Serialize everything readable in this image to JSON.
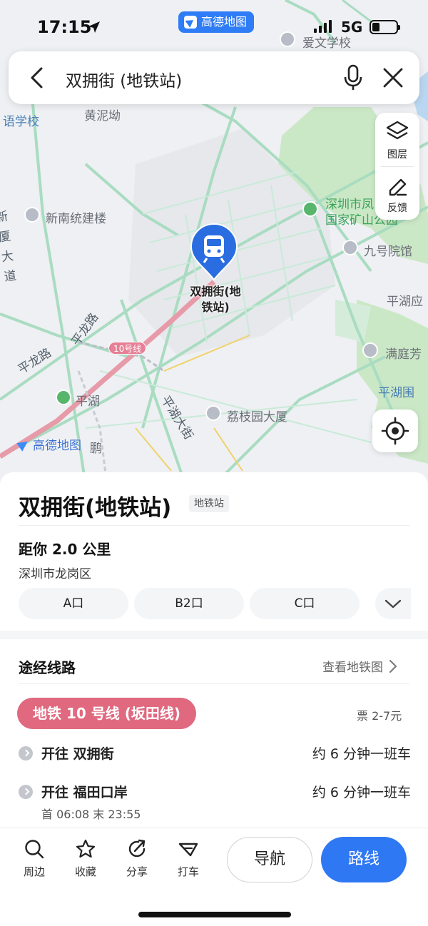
{
  "status": {
    "time": "17:15",
    "network": "5G",
    "app_badge": "高德地图"
  },
  "search": {
    "query": "双拥街 (地铁站)"
  },
  "map_tools": {
    "layers_label": "图层",
    "feedback_label": "反馈"
  },
  "map": {
    "pin_label": "双拥街(地铁站)",
    "line_chip": "10号线",
    "watermark": "高德地图",
    "labels": {
      "aiwen": "爱文学校",
      "yuxue": "语学校",
      "huangni": "黄泥坳",
      "xinnan": "新南统建楼",
      "mine_park_1": "深圳市凤",
      "mine_park_2": "国家矿山公园",
      "jiuhao": "九号院馆",
      "pinghu_right": "平湖应",
      "manting": "满庭芳",
      "pinghuwei": "平湖围",
      "lizhi": "荔枝园大厦",
      "pinghu_station": "平湖",
      "xinxia": "新厦大道",
      "pinglong": "平龙路",
      "pinglong_diag": "平龙路",
      "pinghu_st": "平湖大街",
      "peng": "鹏"
    }
  },
  "place": {
    "title": "双拥街(地铁站)",
    "type_tag": "地铁站",
    "distance": "距你 2.0 公里",
    "district": "深圳市龙岗区",
    "exits": [
      "A口",
      "B2口",
      "C口"
    ]
  },
  "routes": {
    "section_title": "途经线路",
    "view_map": "查看地铁图",
    "line_name": "地铁 10 号线 (坂田线)",
    "fare": "票 2-7元",
    "directions": [
      {
        "dir": "开往 双拥街",
        "freq": "约 6 分钟一班车"
      },
      {
        "dir": "开往 福田口岸",
        "freq": "约 6 分钟一班车"
      }
    ],
    "hours": "首 06:08  末 23:55"
  },
  "actions": {
    "nearby": "周边",
    "favorite": "收藏",
    "share": "分享",
    "taxi": "打车",
    "navigate": "导航",
    "route": "路线"
  },
  "colors": {
    "accent": "#2f78f4",
    "line10": "#e0697f",
    "park": "#c8e6c4",
    "road": "#a8dcc0"
  }
}
